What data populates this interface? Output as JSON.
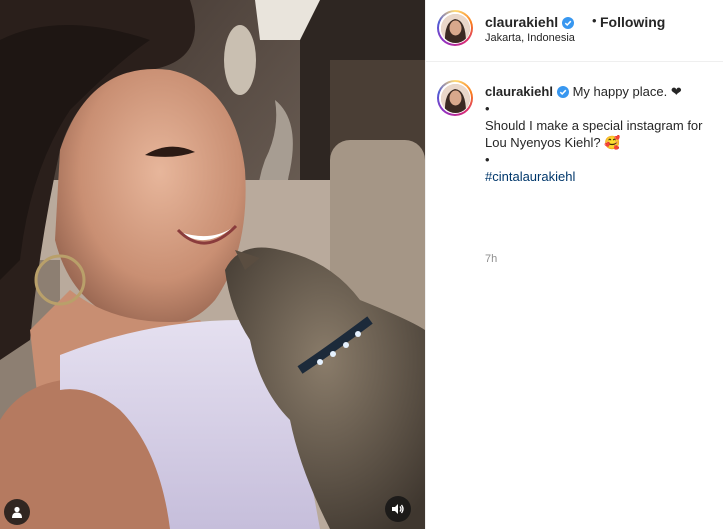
{
  "post": {
    "username": "claurakiehl",
    "following_label": "Following",
    "location": "Jakarta, Indonesia"
  },
  "caption": {
    "username": "claurakiehl",
    "line1": "My happy place. ❤",
    "bullet1": "•",
    "line2": "Should I make a special instagram for Lou Nyenyos Kiehl? 🥰",
    "bullet2": "•",
    "hashtag": "#cintalaurakiehl",
    "time": "7h"
  },
  "media": {
    "controls": [
      "user-tag-icon",
      "audio-icon"
    ]
  }
}
